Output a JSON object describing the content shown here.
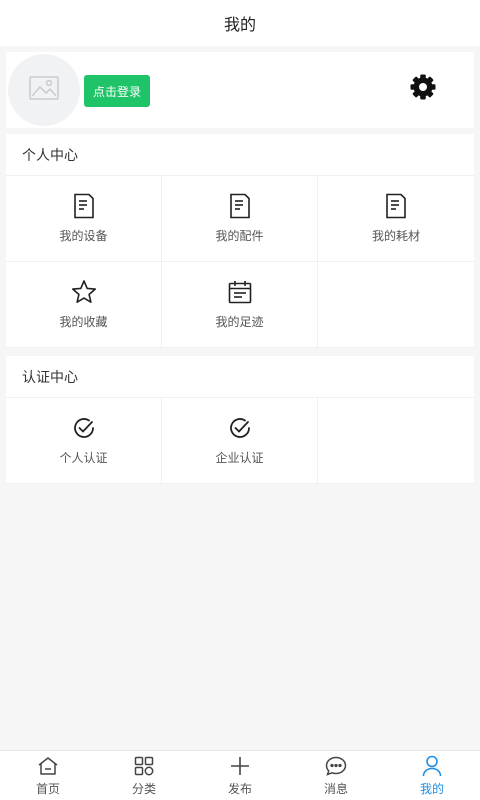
{
  "header": {
    "title": "我的"
  },
  "profile": {
    "login_label": "点击登录",
    "avatar_icon": "image-placeholder-icon",
    "settings_icon": "gear-icon"
  },
  "personal_center": {
    "title": "个人中心",
    "items": [
      {
        "label": "我的设备",
        "icon": "document-icon"
      },
      {
        "label": "我的配件",
        "icon": "document-icon"
      },
      {
        "label": "我的耗材",
        "icon": "document-icon"
      },
      {
        "label": "我的收藏",
        "icon": "star-icon"
      },
      {
        "label": "我的足迹",
        "icon": "calendar-icon"
      }
    ]
  },
  "certification_center": {
    "title": "认证中心",
    "items": [
      {
        "label": "个人认证",
        "icon": "check-circle-icon"
      },
      {
        "label": "企业认证",
        "icon": "check-circle-icon"
      }
    ]
  },
  "tabbar": {
    "active_color": "#1e8ee6",
    "items": [
      {
        "label": "首页",
        "icon": "home-icon"
      },
      {
        "label": "分类",
        "icon": "grid-icon"
      },
      {
        "label": "发布",
        "icon": "plus-icon"
      },
      {
        "label": "消息",
        "icon": "chat-icon"
      },
      {
        "label": "我的",
        "icon": "user-icon",
        "active": true
      }
    ]
  }
}
